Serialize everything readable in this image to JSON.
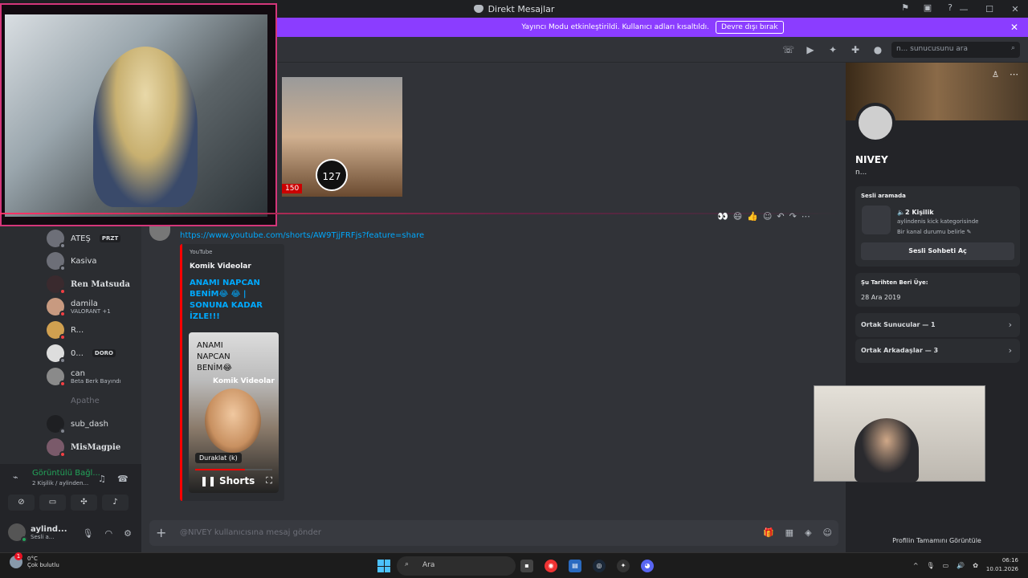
{
  "window": {
    "title": "Direkt Mesajlar",
    "controls": [
      "—",
      "☐",
      "✕"
    ]
  },
  "banner": {
    "text": "Yayıncı Modu etkinleştirildi. Kullanıcı adları kısaltıldı.",
    "button": "Devre dışı bırak"
  },
  "topbar": {
    "search_placeholder": "n... sunucusunu ara"
  },
  "members": [
    {
      "name": "ATEŞ",
      "badge": "PRZT"
    },
    {
      "name": "Kasiva"
    },
    {
      "name": "Ren Matsuda"
    },
    {
      "name": "damila",
      "sub": "VALORANT +1"
    },
    {
      "name": "R..."
    },
    {
      "name": "0...",
      "badge": "DORO"
    },
    {
      "name": "can",
      "sub": "Beta Berk Bayındı"
    },
    {
      "name": "Apathe"
    },
    {
      "name": "sub_dash"
    },
    {
      "name": "MisMagpie"
    }
  ],
  "voice": {
    "status": "Görüntülü Bağl...",
    "sub": "2 Kişilik / aylinden..."
  },
  "user": {
    "name": "aylind...",
    "status": "Sesli a..."
  },
  "message": {
    "link": "https://www.youtube.com/shorts/AW9TjjFRFjs?feature=share",
    "embed": {
      "provider": "YouTube",
      "author": "Komik Videolar",
      "title": "ANAMI NAPCAN BENİM😂 😂 | SONUNA KADAR İZLE!!!",
      "video_title": "ANAMI NAPCAN BENİM😂",
      "video_channel": "Komik Videolar",
      "tooltip": "Duraklat (k)",
      "shorts_label": "Shorts",
      "progress": 0.65
    },
    "thumb_counter": "127",
    "thumb_num": "150"
  },
  "composer": {
    "placeholder": "@NIVEY kullanıcısına mesaj gönder"
  },
  "profile": {
    "name": "NIVEY",
    "sub": "n...",
    "voice_card": {
      "title": "Sesli aramada",
      "count": "🔈2 Kişilik",
      "category": "aylindenis kick kategorisinde",
      "desc": "Bir kanal durumu belirle ✎",
      "button": "Sesli Sohbeti Aç"
    },
    "member_since": {
      "title": "Şu Tarihten Beri Üye:",
      "date": "28 Ara 2019"
    },
    "mutual_servers": "Ortak Sunucular — 1",
    "mutual_friends": "Ortak Arkadaşlar — 3",
    "full_profile": "Profilin Tamamını Görüntüle"
  },
  "taskbar": {
    "temp": "0°C",
    "weather": "Çok bulutlu",
    "notif_count": "1",
    "search": "Ara",
    "time": "06:16",
    "date": "10.01.2026"
  }
}
